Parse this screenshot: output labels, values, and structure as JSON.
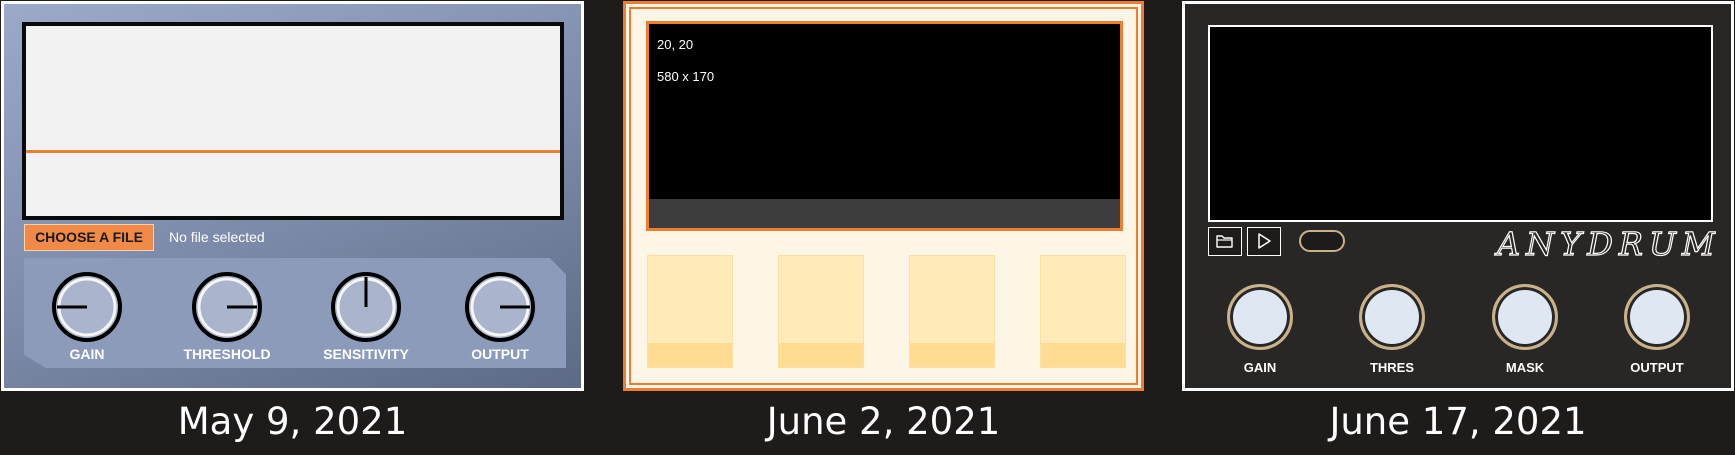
{
  "versions": [
    {
      "caption": "May 9, 2021",
      "file_button_label": "CHOOSE A FILE",
      "file_status": "No file selected",
      "knobs": [
        {
          "label": "GAIN",
          "indicator": "left"
        },
        {
          "label": "THRESHOLD",
          "indicator": "right"
        },
        {
          "label": "SENSITIVITY",
          "indicator": "up"
        },
        {
          "label": "OUTPUT",
          "indicator": "right"
        }
      ]
    },
    {
      "caption": "June 2, 2021",
      "screen_position_text": "20, 20",
      "screen_size_text": "580 x 170",
      "pad_count": 4
    },
    {
      "caption": "June 17, 2021",
      "logo_text": "ANYDRUM",
      "buttons": [
        {
          "icon": "folder-icon"
        },
        {
          "icon": "play-icon"
        }
      ],
      "knobs": [
        {
          "label": "GAIN"
        },
        {
          "label": "THRES"
        },
        {
          "label": "MASK"
        },
        {
          "label": "OUTPUT"
        }
      ]
    }
  ],
  "colors": {
    "background": "#1e1b1b",
    "accent_orange": "#ed7d31",
    "panel1_blue": "#7b8aa8",
    "panel2_cream": "#fdf6e6",
    "panel3_dark": "#292725",
    "panel3_gold": "#c9b28a"
  }
}
